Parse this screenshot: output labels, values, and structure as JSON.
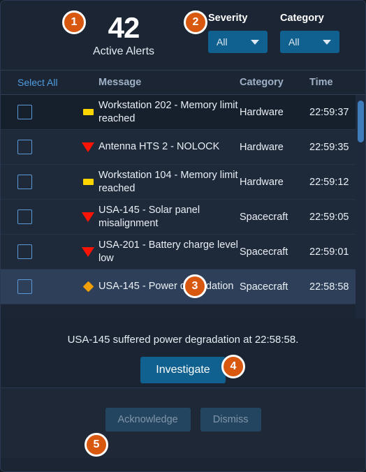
{
  "header": {
    "kpi_value": "42",
    "kpi_label": "Active Alerts",
    "filters": [
      {
        "label": "Severity",
        "value": "All",
        "caret_icon": "chevron-down-icon"
      },
      {
        "label": "Category",
        "value": "All",
        "caret_icon": "chevron-down-icon"
      }
    ]
  },
  "table": {
    "select_all_label": "Select All",
    "columns": [
      "Message",
      "Category",
      "Time"
    ],
    "rows": [
      {
        "severity": "warning",
        "message": "Workstation 202 - Memory limit reached",
        "category": "Hardware",
        "time": "22:59:37",
        "checked": false,
        "state": "hovered"
      },
      {
        "severity": "critical",
        "message": "Antenna HTS 2 - NOLOCK",
        "category": "Hardware",
        "time": "22:59:35",
        "checked": false,
        "state": "normal"
      },
      {
        "severity": "warning",
        "message": "Workstation 104 - Memory limit reached",
        "category": "Hardware",
        "time": "22:59:12",
        "checked": false,
        "state": "normal"
      },
      {
        "severity": "critical",
        "message": "USA-145 - Solar panel misalignment",
        "category": "Spacecraft",
        "time": "22:59:05",
        "checked": false,
        "state": "normal"
      },
      {
        "severity": "critical",
        "message": "USA-201 - Battery charge level low",
        "category": "Spacecraft",
        "time": "22:59:01",
        "checked": false,
        "state": "normal"
      },
      {
        "severity": "caution",
        "message": "USA-145 - Power degradation",
        "category": "Spacecraft",
        "time": "22:58:58",
        "checked": false,
        "state": "selected"
      }
    ]
  },
  "detail": {
    "text": "USA-145 suffered power degradation at 22:58:58.",
    "investigate_label": "Investigate"
  },
  "footer": {
    "acknowledge_label": "Acknowledge",
    "dismiss_label": "Dismiss"
  },
  "step_badges": [
    {
      "number": "1"
    },
    {
      "number": "2"
    },
    {
      "number": "3"
    },
    {
      "number": "4"
    },
    {
      "number": "5"
    }
  ],
  "colors": {
    "accent_blue": "#10618f",
    "badge_orange": "#d9580f",
    "severity_warning": "#ffd500",
    "severity_critical": "#fa1406",
    "severity_caution": "#f2a007",
    "panel_bg": "#1b2533",
    "row_selected": "#2e4059"
  }
}
